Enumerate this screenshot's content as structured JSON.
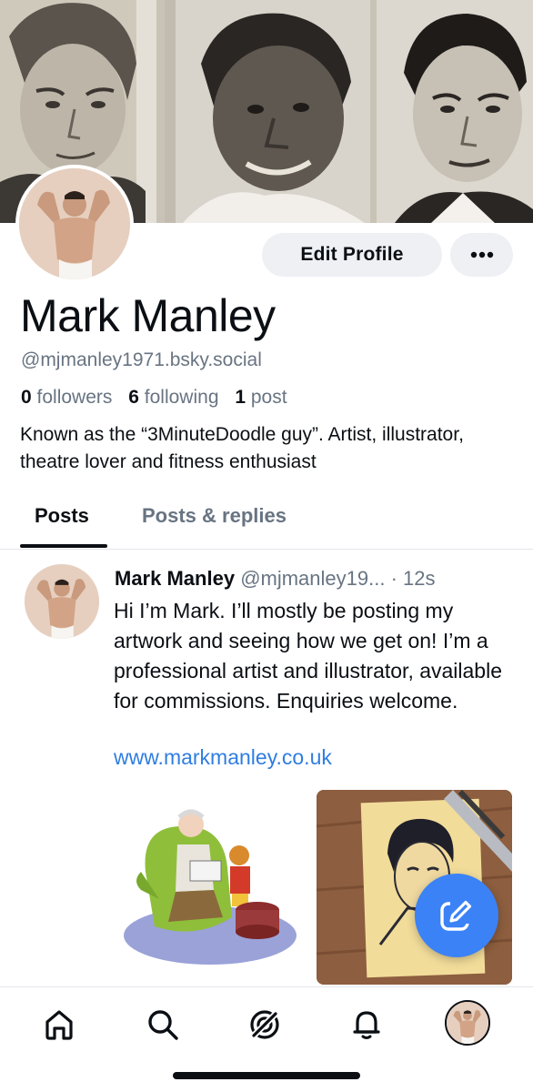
{
  "profile": {
    "display_name": "Mark Manley",
    "handle": "@mjmanley1971.bsky.social",
    "followers_count": "0",
    "followers_label": "followers",
    "following_count": "6",
    "following_label": "following",
    "posts_count": "1",
    "posts_label": "post",
    "bio": "Known as the “3MinuteDoodle guy”. Artist, illustrator, theatre lover and fitness enthusiast"
  },
  "actions": {
    "edit_profile_label": "Edit Profile",
    "more_icon": "ellipsis-icon"
  },
  "tabs": [
    {
      "label": "Posts",
      "active": true
    },
    {
      "label": "Posts & replies",
      "active": false
    }
  ],
  "post": {
    "author": "Mark Manley",
    "handle": "@mjmanley19...",
    "time": "· 12s",
    "text": "Hi I’m Mark. I’ll mostly be posting my artwork and seeing how we get on! I’m a professional artist and illustrator, available for commissions. Enquiries welcome.",
    "link": "www.markmanley.co.uk"
  },
  "nav": {
    "items": [
      "home-icon",
      "search-icon",
      "feeds-icon",
      "notifications-icon",
      "profile-avatar"
    ]
  },
  "colors": {
    "accent": "#3b82f6",
    "link": "#2f7de1",
    "secondary_text": "#687482",
    "button_bg": "#eef0f4"
  }
}
